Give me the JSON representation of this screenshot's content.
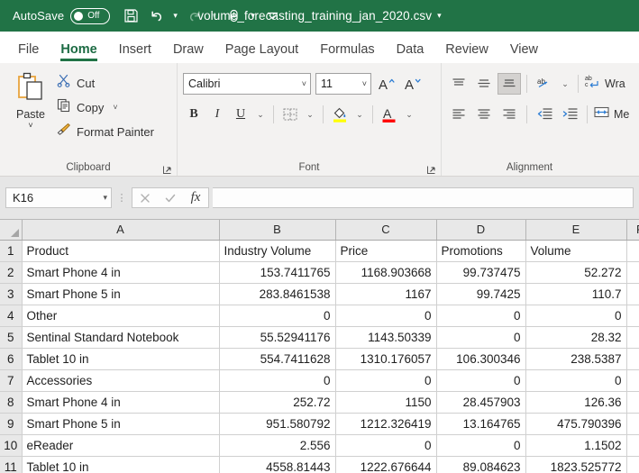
{
  "titlebar": {
    "autosave_label": "AutoSave",
    "autosave_state": "Off",
    "filename": "volume_forecasting_training_jan_2020.csv",
    "caret": "▾",
    "save_icon": "save-icon",
    "undo_icon": "undo-icon",
    "redo_icon": "redo-icon",
    "touch_icon": "touch-mode-icon",
    "customize_icon": "customize-quick-access-icon"
  },
  "tabs": [
    {
      "label": "File",
      "active": false
    },
    {
      "label": "Home",
      "active": true
    },
    {
      "label": "Insert",
      "active": false
    },
    {
      "label": "Draw",
      "active": false
    },
    {
      "label": "Page Layout",
      "active": false
    },
    {
      "label": "Formulas",
      "active": false
    },
    {
      "label": "Data",
      "active": false
    },
    {
      "label": "Review",
      "active": false
    },
    {
      "label": "View",
      "active": false
    }
  ],
  "ribbon": {
    "clipboard": {
      "group_label": "Clipboard",
      "paste_label": "Paste",
      "paste_caret": "˅",
      "cut_label": "Cut",
      "copy_label": "Copy",
      "copy_caret": "˅",
      "format_painter_label": "Format Painter"
    },
    "font": {
      "group_label": "Font",
      "font_name": "Calibri",
      "font_size": "11",
      "caret": "˅",
      "grow_font": "A",
      "shrink_font": "A",
      "bold": "B",
      "italic": "I",
      "underline": "U",
      "fill_color": "#ffff00",
      "font_color": "#ff0000"
    },
    "alignment": {
      "group_label": "Alignment",
      "wrap_text_label": "Wra",
      "merge_label": "Me"
    }
  },
  "formula_bar": {
    "name_box": "K16",
    "name_box_caret": "▾",
    "cancel_icon": "cancel-icon",
    "enter_icon": "confirm-icon",
    "function_icon": "fx",
    "formula_value": ""
  },
  "sheet": {
    "columns": [
      "A",
      "B",
      "C",
      "D",
      "E",
      "F"
    ],
    "rows": [
      {
        "n": "1",
        "cells": [
          "Product",
          "Industry Volume",
          "Price",
          "Promotions",
          "Volume",
          ""
        ],
        "numeric": false
      },
      {
        "n": "2",
        "cells": [
          "Smart Phone 4 in",
          "153.7411765",
          "1168.903668",
          "99.737475",
          "52.272",
          ""
        ],
        "numeric": true
      },
      {
        "n": "3",
        "cells": [
          "Smart Phone 5 in",
          "283.8461538",
          "1167",
          "99.7425",
          "110.7",
          ""
        ],
        "numeric": true
      },
      {
        "n": "4",
        "cells": [
          "Other",
          "0",
          "0",
          "0",
          "0",
          ""
        ],
        "numeric": true
      },
      {
        "n": "5",
        "cells": [
          "Sentinal Standard Notebook",
          "55.52941176",
          "1143.50339",
          "0",
          "28.32",
          ""
        ],
        "numeric": true
      },
      {
        "n": "6",
        "cells": [
          "Tablet 10 in",
          "554.7411628",
          "1310.176057",
          "106.300346",
          "238.5387",
          ""
        ],
        "numeric": true
      },
      {
        "n": "7",
        "cells": [
          "Accessories",
          "0",
          "0",
          "0",
          "0",
          ""
        ],
        "numeric": true
      },
      {
        "n": "8",
        "cells": [
          "Smart Phone 4 in",
          "252.72",
          "1150",
          "28.457903",
          "126.36",
          ""
        ],
        "numeric": true
      },
      {
        "n": "9",
        "cells": [
          "Smart Phone 5 in",
          "951.580792",
          "1212.326419",
          "13.164765",
          "475.790396",
          ""
        ],
        "numeric": true
      },
      {
        "n": "10",
        "cells": [
          "eReader",
          "2.556",
          "0",
          "0",
          "1.1502",
          ""
        ],
        "numeric": true
      },
      {
        "n": "11",
        "cells": [
          "Tablet 10 in",
          "4558.81443",
          "1222.676644",
          "89.084623",
          "1823.525772",
          ""
        ],
        "numeric": true
      }
    ]
  }
}
